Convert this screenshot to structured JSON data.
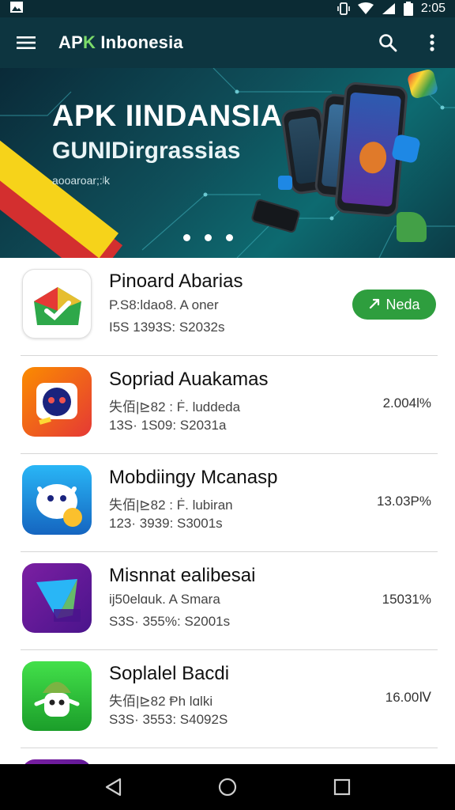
{
  "status_bar": {
    "time": "2:05"
  },
  "app_bar": {
    "title_prefix": "AP",
    "title_accent": "K",
    "title_rest": " Inbonesia"
  },
  "banner": {
    "title": "APK IINDANSIA",
    "subtitle": "GUNIDirgrassias",
    "small_text": "aooaroar;:ʲk",
    "slide_count": 3
  },
  "apps": [
    {
      "name": "Pinoard Abarias",
      "developer": "P.S8:ldao8. A oner",
      "meta": "I5S  1393S: S2032s",
      "action_label": "Neda",
      "stat": ""
    },
    {
      "name": "Sopriad Auakamas",
      "developer": "失佰|⊵82 : Ḟ. luddeda",
      "meta": "13S· 1S09:  S2031a",
      "action_label": "",
      "stat": "2.004l%"
    },
    {
      "name": "Mobdiingy Mcanasp",
      "developer": "失佰|⊵82 : Ḟ. lubiran",
      "meta": "123· 3939:  S3001s",
      "action_label": "",
      "stat": "13.03P%"
    },
    {
      "name": "Misnnat ealibesai",
      "developer": "ĳ50elɑuk. A Smara",
      "meta": "S3S· 355%:  S2001s",
      "action_label": "",
      "stat": "15031%"
    },
    {
      "name": "Soplalel Bacdi",
      "developer": "失佰|⊵82  Ᵽh lɑlki",
      "meta": "S3S· 3553:  S4092S",
      "action_label": "",
      "stat": "16.00Ⅳ"
    }
  ],
  "colors": {
    "status_bar": "#0b2b34",
    "app_bar": "#0d3540",
    "accent_green": "#7cdc6a",
    "install_green": "#2e9e3e"
  },
  "icons": {
    "menu": "menu-icon",
    "search": "search-icon",
    "more": "more-vert-icon",
    "back": "back-triangle-icon",
    "home": "home-circle-icon",
    "recents": "recents-square-icon"
  }
}
